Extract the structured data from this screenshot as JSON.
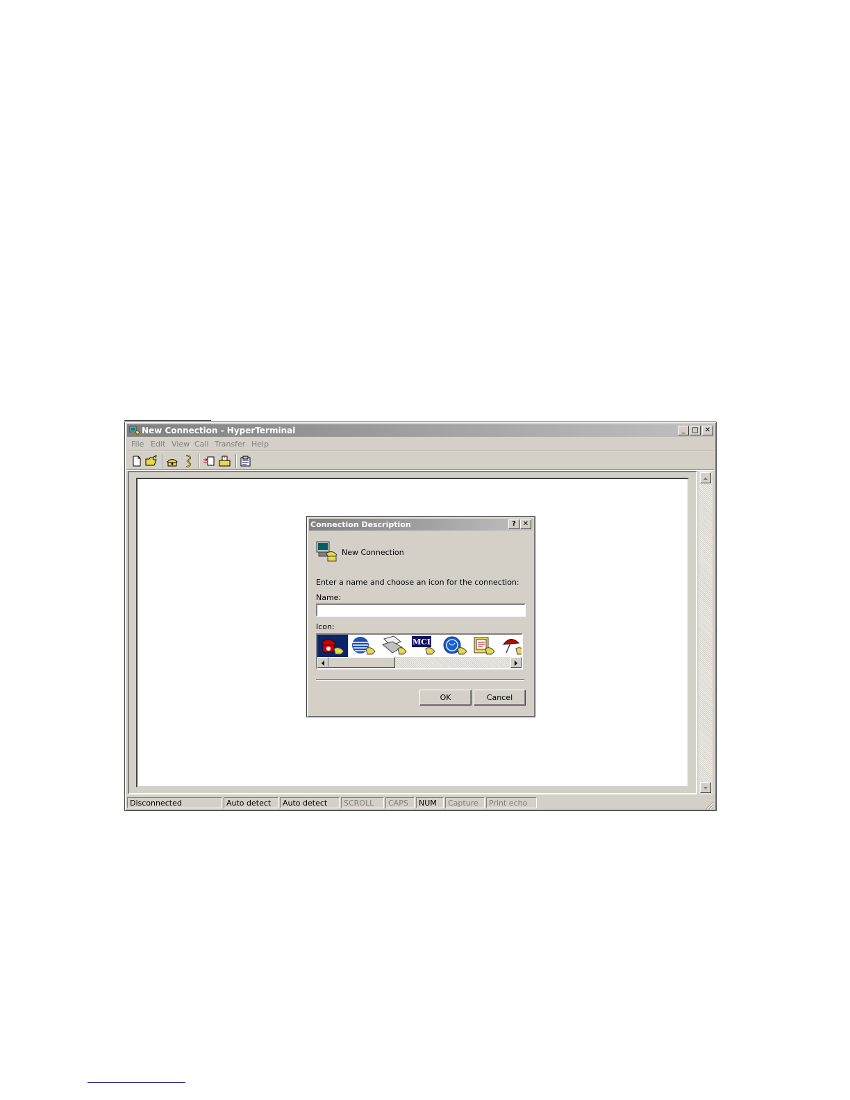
{
  "window": {
    "title": "New Connection - HyperTerminal",
    "controls": {
      "minimize": "_",
      "maximize": "□",
      "close": "✕"
    }
  },
  "menubar": [
    "File",
    "Edit",
    "View",
    "Call",
    "Transfer",
    "Help"
  ],
  "toolbar": {
    "icons": [
      "new-document-icon",
      "open-folder-icon",
      "call-phone-icon",
      "disconnect-phone-icon",
      "send-file-icon",
      "receive-file-icon",
      "properties-icon"
    ]
  },
  "statusbar": {
    "panes": [
      {
        "label": "Disconnected",
        "enabled": true
      },
      {
        "label": "Auto detect",
        "enabled": true
      },
      {
        "label": "Auto detect",
        "enabled": true
      },
      {
        "label": "SCROLL",
        "enabled": false
      },
      {
        "label": "CAPS",
        "enabled": false
      },
      {
        "label": "NUM",
        "enabled": true
      },
      {
        "label": "Capture",
        "enabled": false
      },
      {
        "label": "Print echo",
        "enabled": false
      }
    ]
  },
  "dialog": {
    "title": "Connection Description",
    "help_button": "?",
    "close_button": "✕",
    "header_label": "New Connection",
    "instruction": "Enter a name and choose an icon for the connection:",
    "name_label": "Name:",
    "name_value": "",
    "icon_label": "Icon:",
    "icon_choices": [
      "red-phone-icon",
      "att-globe-icon",
      "fax-machine-icon",
      "mci-icon",
      "ge-globe-icon",
      "document-phone-icon",
      "umbrella-icon"
    ],
    "selected_icon": "red-phone-icon",
    "ok_label": "OK",
    "cancel_label": "Cancel"
  },
  "colors": {
    "titlebar_inactive_start": "#808080",
    "titlebar_inactive_end": "#c0c0c0",
    "face": "#d4d0c8",
    "selection": "#0a246a"
  }
}
